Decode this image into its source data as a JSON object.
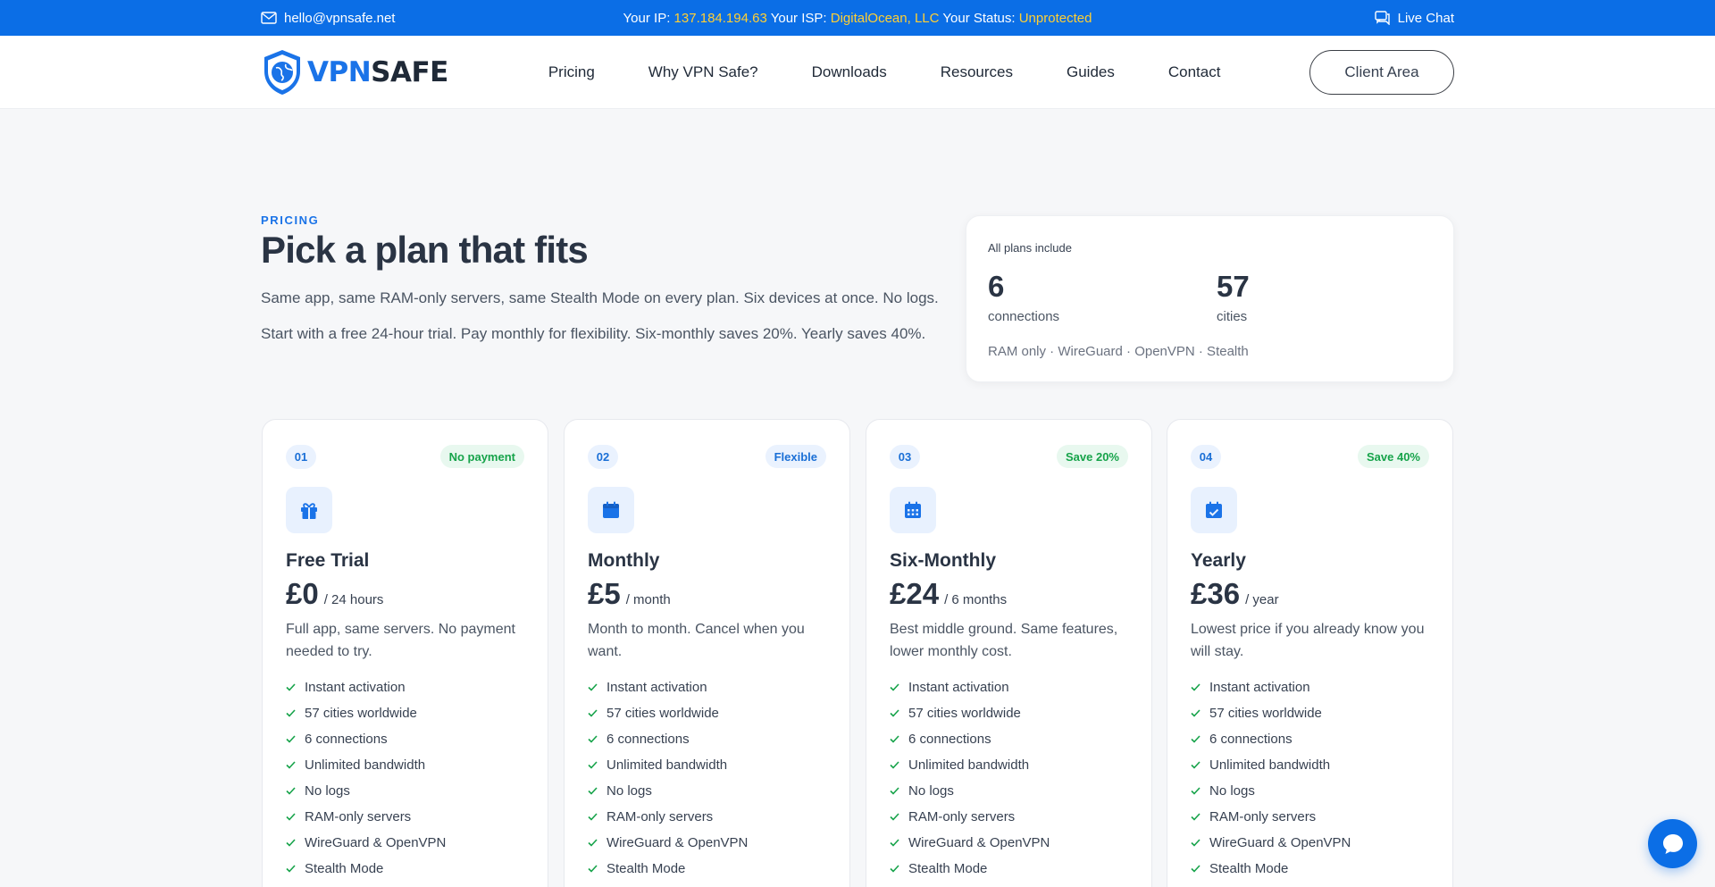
{
  "topbar": {
    "email": "hello@vpnsafe.net",
    "ip_label": "Your IP:",
    "ip_value": "137.184.194.63",
    "isp_label": "Your ISP:",
    "isp_value": "DigitalOcean, LLC",
    "status_label": "Your Status:",
    "status_value": "Unprotected",
    "live_chat": "Live Chat"
  },
  "nav": {
    "logo_vpn": "VPN",
    "logo_safe": "SAFE",
    "items": [
      "Pricing",
      "Why VPN Safe?",
      "Downloads",
      "Resources",
      "Guides",
      "Contact"
    ],
    "client_area": "Client Area"
  },
  "hero": {
    "eyebrow": "PRICING",
    "title": "Pick a plan that fits",
    "lead1": "Same app, same RAM-only servers, same Stealth Mode on every plan. Six devices at once. No logs.",
    "lead2": "Start with a free 24-hour trial. Pay monthly for flexibility. Six-monthly saves 20%. Yearly saves 40%."
  },
  "summary": {
    "label": "All plans include",
    "stats": [
      {
        "value": "6",
        "caption": "connections"
      },
      {
        "value": "57",
        "caption": "cities"
      }
    ],
    "features": "RAM only · WireGuard · OpenVPN · Stealth"
  },
  "plans": [
    {
      "number": "01",
      "tag": "No payment",
      "tag_color": "green",
      "icon": "gift-icon",
      "name": "Free Trial",
      "price": "£0",
      "period": "/ 24 hours",
      "desc": "Full app, same servers. No payment needed to try.",
      "features": [
        "Instant activation",
        "57 cities worldwide",
        "6 connections",
        "Unlimited bandwidth",
        "No logs",
        "RAM-only servers",
        "WireGuard & OpenVPN",
        "Stealth Mode"
      ]
    },
    {
      "number": "02",
      "tag": "Flexible",
      "tag_color": "blue",
      "icon": "calendar-icon",
      "name": "Monthly",
      "price": "£5",
      "period": "/ month",
      "desc": "Month to month. Cancel when you want.",
      "features": [
        "Instant activation",
        "57 cities worldwide",
        "6 connections",
        "Unlimited bandwidth",
        "No logs",
        "RAM-only servers",
        "WireGuard & OpenVPN",
        "Stealth Mode"
      ]
    },
    {
      "number": "03",
      "tag": "Save 20%",
      "tag_color": "green",
      "icon": "calendar-grid-icon",
      "name": "Six-Monthly",
      "price": "£24",
      "period": "/ 6 months",
      "desc": "Best middle ground. Same features, lower monthly cost.",
      "features": [
        "Instant activation",
        "57 cities worldwide",
        "6 connections",
        "Unlimited bandwidth",
        "No logs",
        "RAM-only servers",
        "WireGuard & OpenVPN",
        "Stealth Mode"
      ]
    },
    {
      "number": "04",
      "tag": "Save 40%",
      "tag_color": "green",
      "icon": "calendar-check-icon",
      "name": "Yearly",
      "price": "£36",
      "period": "/ year",
      "desc": "Lowest price if you already know you will stay.",
      "features": [
        "Instant activation",
        "57 cities worldwide",
        "6 connections",
        "Unlimited bandwidth",
        "No logs",
        "RAM-only servers",
        "WireGuard & OpenVPN",
        "Stealth Mode"
      ]
    }
  ],
  "colors": {
    "brand": "#0b6ee6",
    "status_highlight": "#ffcf33",
    "success": "#16a34a"
  }
}
